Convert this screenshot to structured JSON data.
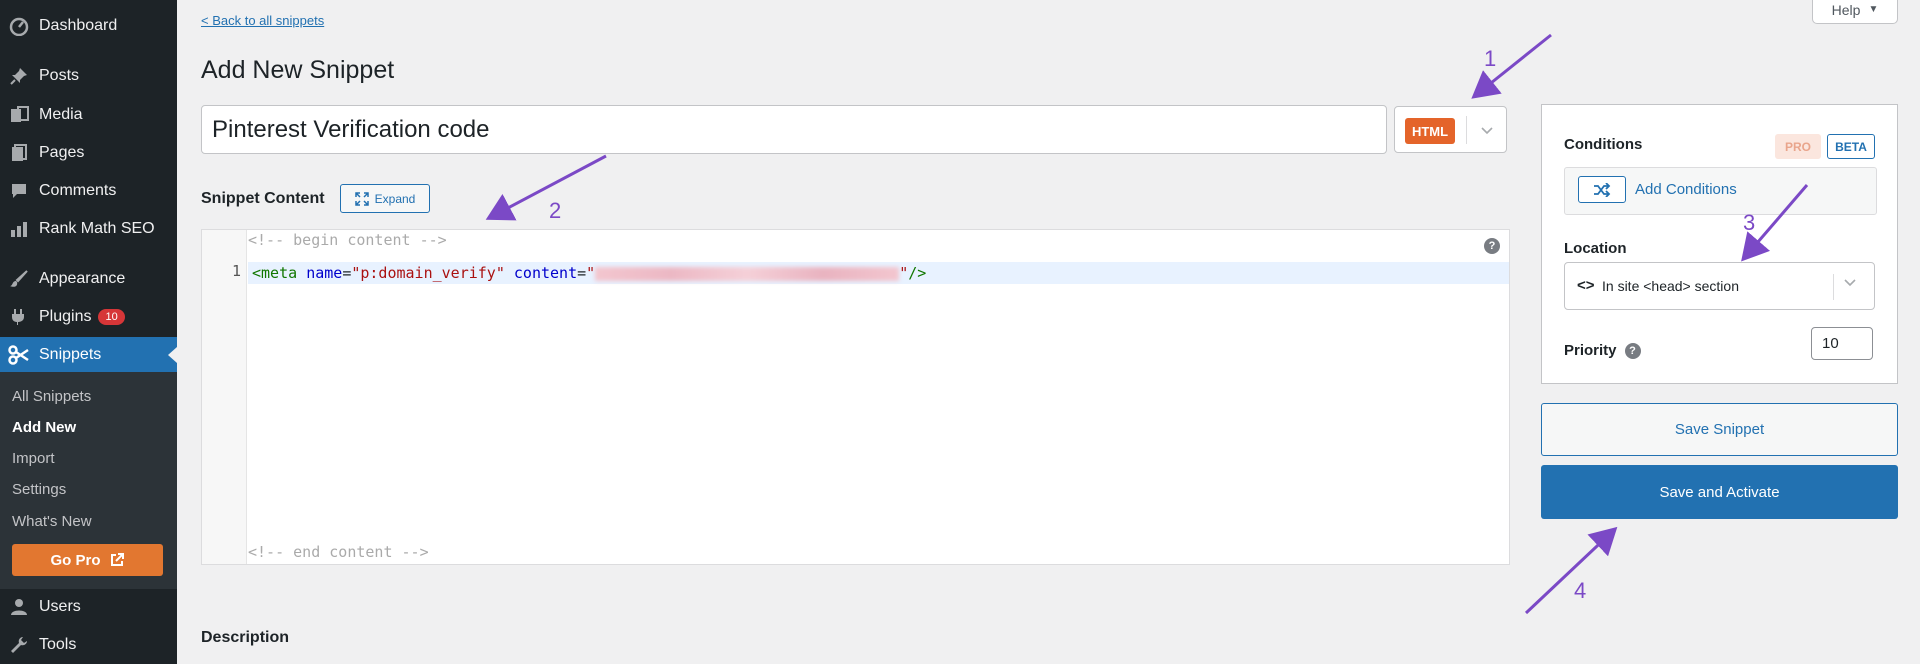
{
  "sidebar": {
    "items": [
      {
        "label": "Dashboard",
        "icon": "dashboard-icon"
      },
      {
        "label": "Posts",
        "icon": "pin-icon"
      },
      {
        "label": "Media",
        "icon": "media-icon"
      },
      {
        "label": "Pages",
        "icon": "pages-icon"
      },
      {
        "label": "Comments",
        "icon": "comment-icon"
      },
      {
        "label": "Rank Math SEO",
        "icon": "chart-icon"
      },
      {
        "label": "Appearance",
        "icon": "brush-icon"
      },
      {
        "label": "Plugins",
        "icon": "plugin-icon",
        "badge": "10"
      },
      {
        "label": "Snippets",
        "icon": "scissors-icon"
      },
      {
        "label": "Users",
        "icon": "user-icon"
      },
      {
        "label": "Tools",
        "icon": "wrench-icon"
      }
    ],
    "submenu": [
      "All Snippets",
      "Add New",
      "Import",
      "Settings",
      "What's New"
    ],
    "go_pro": "Go Pro"
  },
  "header": {
    "back_link": "< Back to all snippets",
    "help": "Help",
    "title": "Add New Snippet"
  },
  "snippet": {
    "title_value": "Pinterest Verification code",
    "type_badge": "HTML",
    "content_label": "Snippet Content",
    "expand_label": "Expand",
    "comment_begin": "<!-- begin content -->",
    "comment_end": "<!-- end content -->",
    "line_number": "1",
    "code": {
      "open": "<meta",
      "attr1": "name",
      "val1": "\"p:domain_verify\"",
      "attr2": "content",
      "val2_open": "\"",
      "val2_close": "\"",
      "close": "/>"
    },
    "description_label": "Description"
  },
  "panel": {
    "conditions_label": "Conditions",
    "pro_badge": "PRO",
    "beta_badge": "BETA",
    "add_conditions": "Add Conditions",
    "location_label": "Location",
    "location_value": "In site <head> section",
    "priority_label": "Priority",
    "priority_value": "10"
  },
  "buttons": {
    "save": "Save Snippet",
    "save_activate": "Save and Activate"
  },
  "annotations": [
    "1",
    "2",
    "3",
    "4"
  ],
  "colors": {
    "sidebar_bg": "#1d2327",
    "accent": "#2271b1",
    "html_badge": "#e4642a",
    "go_pro": "#e27730",
    "annotation": "#7b49c6"
  }
}
